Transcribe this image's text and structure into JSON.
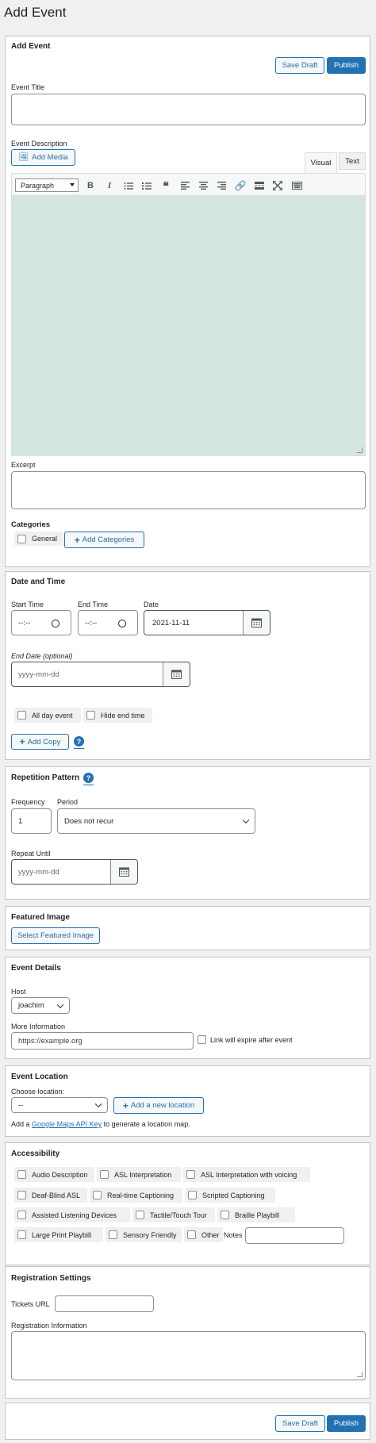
{
  "page_title": "Add Event",
  "add_event": {
    "heading": "Add Event",
    "save_draft": "Save Draft",
    "publish": "Publish",
    "event_title_label": "Event Title",
    "event_title_value": "",
    "description_label": "Event Description",
    "add_media": "Add Media",
    "tab_visual": "Visual",
    "tab_text": "Text",
    "format_select": "Paragraph",
    "excerpt_label": "Excerpt",
    "categories_label": "Categories",
    "category_general": "General",
    "add_categories": "Add Categories"
  },
  "date_time": {
    "heading": "Date and Time",
    "start_time_label": "Start Time",
    "start_time_value": "--:--",
    "end_time_label": "End Time",
    "end_time_value": "--:--",
    "date_label": "Date",
    "date_value": "2021-11-11",
    "end_date_label": "End Date (optional)",
    "end_date_placeholder": "yyyy-mm-dd",
    "all_day_event": "All day event",
    "hide_end_time": "Hide end time",
    "add_copy": "Add Copy",
    "help": "?"
  },
  "repetition": {
    "heading": "Repetition Pattern",
    "help": "?",
    "frequency_label": "Frequency",
    "frequency_value": "1",
    "period_label": "Period",
    "period_value": "Does not recur",
    "repeat_until_label": "Repeat Until",
    "repeat_until_placeholder": "yyyy-mm-dd"
  },
  "featured_image": {
    "heading": "Featured Image",
    "select_button": "Select Featured Image"
  },
  "event_details": {
    "heading": "Event Details",
    "host_label": "Host",
    "host_value": "joachim",
    "more_info_label": "More Information",
    "more_info_placeholder": "https://example.org",
    "link_expire": "Link will expire after event"
  },
  "event_location": {
    "heading": "Event Location",
    "choose_label": "Choose location:",
    "choose_value": "--",
    "add_location": "Add a new location",
    "maps_prefix": "Add a",
    "maps_link": "Google Maps API Key",
    "maps_suffix": "to generate a location map."
  },
  "accessibility": {
    "heading": "Accessibility",
    "audio_description": "Audio Description",
    "asl_interpretation": "ASL Interpretation",
    "asl_voicing": "ASL Interpretation with voicing",
    "deaf_blind_asl": "Deaf-Blind ASL",
    "realtime_captioning": "Real-time Captioning",
    "scripted_captioning": "Scripted Captioning",
    "assisted_listening": "Assisted Listening Devices",
    "tactile_tour": "Tactile/Touch Tour",
    "braille_playbill": "Braille Playbill",
    "large_print": "Large Print Playbill",
    "sensory_friendly": "Sensory Friendly",
    "other": "Other",
    "notes_label": "Notes"
  },
  "registration": {
    "heading": "Registration Settings",
    "tickets_url_label": "Tickets URL",
    "reg_info_label": "Registration Information"
  },
  "footer": {
    "save_draft": "Save Draft",
    "publish": "Publish"
  }
}
